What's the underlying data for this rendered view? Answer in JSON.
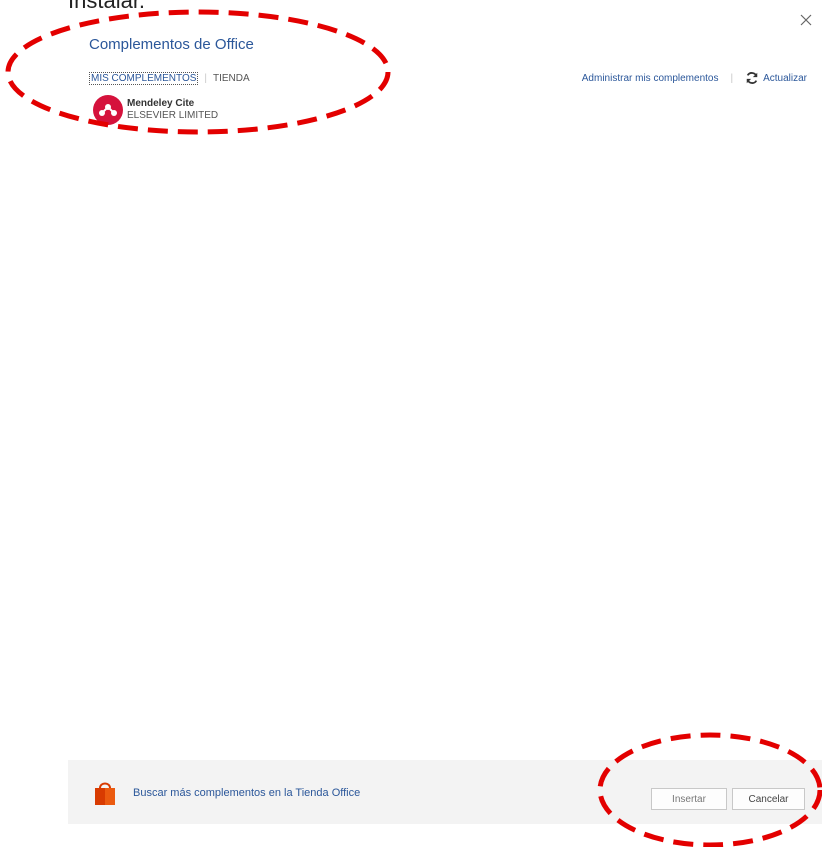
{
  "document": {
    "partial_text": "Instalar."
  },
  "dialog": {
    "title": "Complementos de Office",
    "tabs": {
      "active": "MIS COMPLEMENTOS",
      "other": "TIENDA"
    },
    "actions": {
      "manage": "Administrar mis complementos",
      "refresh": "Actualizar"
    },
    "addins": [
      {
        "name": "Mendeley Cite",
        "vendor": "ELSEVIER LIMITED",
        "logo_color": "#d5123c"
      }
    ],
    "footer": {
      "store_link": "Buscar más complementos en la Tienda Office",
      "insert_label": "Insertar",
      "cancel_label": "Cancelar"
    }
  },
  "colors": {
    "accent": "#2b579a",
    "annotation": "#e30000",
    "footer_bg": "#f3f3f3"
  },
  "icons": {
    "close": "close-icon",
    "refresh": "refresh-icon",
    "store": "store-bag-icon",
    "addin_logo": "mendeley-logo-icon"
  }
}
